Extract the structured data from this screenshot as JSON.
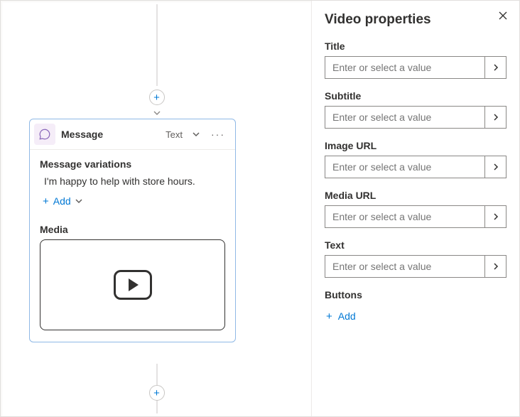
{
  "canvas": {
    "card": {
      "title": "Message",
      "type_label": "Text",
      "variations_label": "Message variations",
      "variation_text": "I'm happy to help with store hours.",
      "add_label": "Add",
      "media_label": "Media"
    }
  },
  "props": {
    "panel_title": "Video properties",
    "fields": {
      "title": {
        "label": "Title",
        "placeholder": "Enter or select a value"
      },
      "subtitle": {
        "label": "Subtitle",
        "placeholder": "Enter or select a value"
      },
      "image_url": {
        "label": "Image URL",
        "placeholder": "Enter or select a value"
      },
      "media_url": {
        "label": "Media URL",
        "placeholder": "Enter or select a value"
      },
      "text": {
        "label": "Text",
        "placeholder": "Enter or select a value"
      }
    },
    "buttons_label": "Buttons",
    "add_button_label": "Add"
  }
}
